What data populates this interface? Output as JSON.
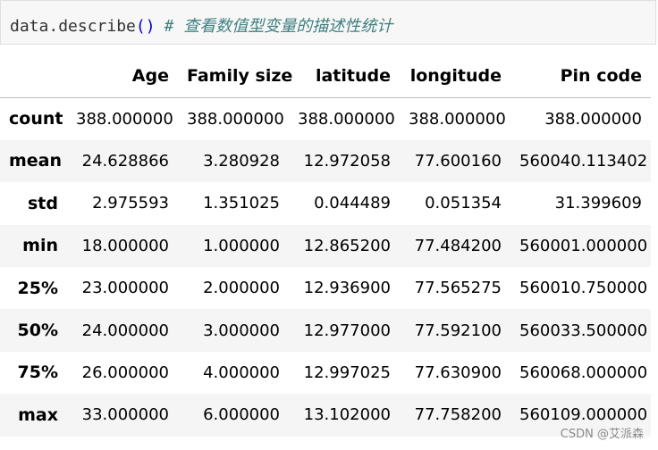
{
  "code": {
    "object": "data",
    "dot": ".",
    "method": "describe",
    "parens": "()",
    "comment": "# 查看数值型变量的描述性统计"
  },
  "table": {
    "columns": [
      "Age",
      "Family size",
      "latitude",
      "longitude",
      "Pin code"
    ],
    "rows": [
      {
        "index": "count",
        "values": [
          "388.000000",
          "388.000000",
          "388.000000",
          "388.000000",
          "388.000000"
        ]
      },
      {
        "index": "mean",
        "values": [
          "24.628866",
          "3.280928",
          "12.972058",
          "77.600160",
          "560040.113402"
        ]
      },
      {
        "index": "std",
        "values": [
          "2.975593",
          "1.351025",
          "0.044489",
          "0.051354",
          "31.399609"
        ]
      },
      {
        "index": "min",
        "values": [
          "18.000000",
          "1.000000",
          "12.865200",
          "77.484200",
          "560001.000000"
        ]
      },
      {
        "index": "25%",
        "values": [
          "23.000000",
          "2.000000",
          "12.936900",
          "77.565275",
          "560010.750000"
        ]
      },
      {
        "index": "50%",
        "values": [
          "24.000000",
          "3.000000",
          "12.977000",
          "77.592100",
          "560033.500000"
        ]
      },
      {
        "index": "75%",
        "values": [
          "26.000000",
          "4.000000",
          "12.997025",
          "77.630900",
          "560068.000000"
        ]
      },
      {
        "index": "max",
        "values": [
          "33.000000",
          "6.000000",
          "13.102000",
          "77.758200",
          "560109.000000"
        ]
      }
    ]
  },
  "watermark": "CSDN @艾派森"
}
